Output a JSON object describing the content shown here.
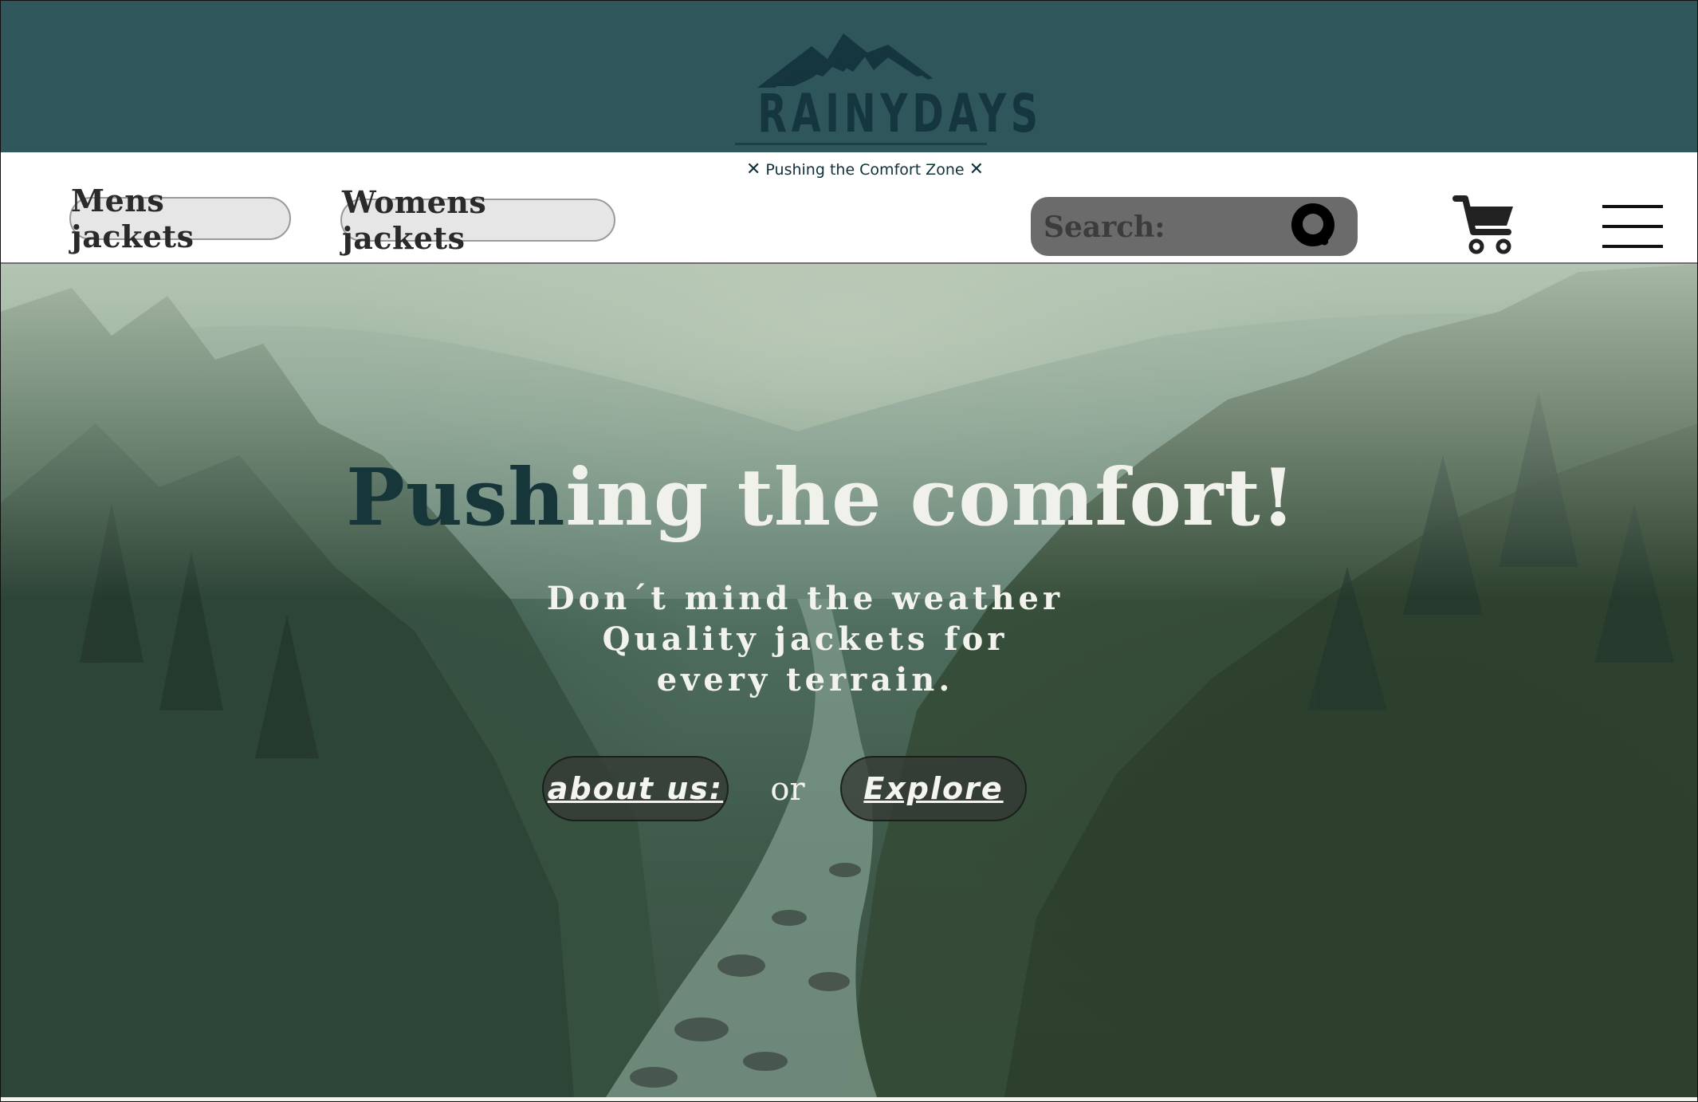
{
  "brand": {
    "logo_text": "RAINYDAYS",
    "tagline": "Pushing the Comfort Zone",
    "banner_color": "#2f565b"
  },
  "nav": {
    "categories": [
      {
        "label": "Mens jackets"
      },
      {
        "label": "Womens jackets"
      }
    ],
    "search": {
      "placeholder": "Search:",
      "icon": "search-icon"
    },
    "cart_icon": "cart-icon",
    "menu_icon": "hamburger-menu-icon"
  },
  "hero": {
    "title_dark": "Push",
    "title_light": "ing the comfort!",
    "subtitle_lines": [
      "Don´t mind the weather",
      "Quality jackets for",
      "every terrain."
    ],
    "about_label": "about us:",
    "or_text": "or",
    "explore_label": "Explore"
  }
}
